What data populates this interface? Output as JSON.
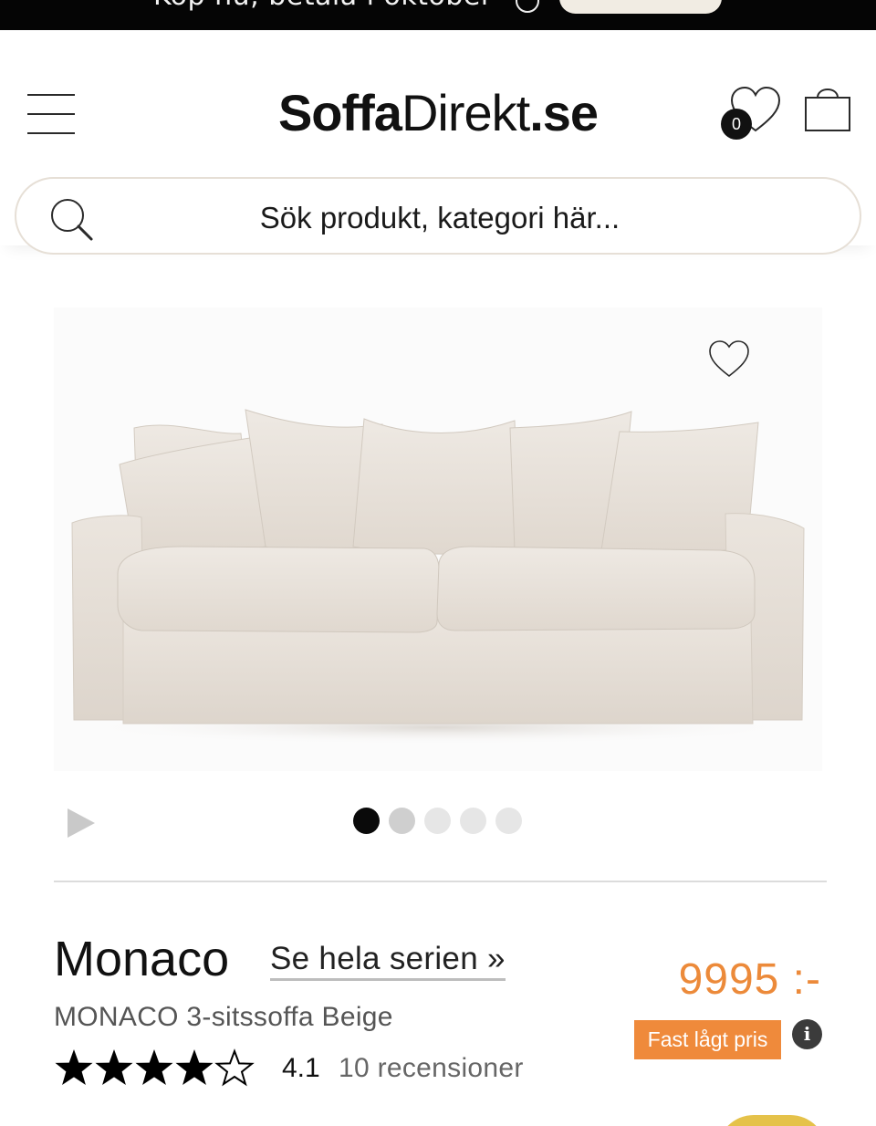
{
  "banner": {
    "text": "Köp nu, betala i oktober"
  },
  "header": {
    "logo_bold": "Soffa",
    "logo_light": "Direkt",
    "logo_suffix": ".se",
    "wishlist_count": "0"
  },
  "search": {
    "placeholder": "Sök produkt, kategori här..."
  },
  "gallery": {
    "image_subject": "beige three-seat sofa with loose cushions",
    "slide_count": 5,
    "active_slide": 1
  },
  "product": {
    "name": "Monaco",
    "series_link": "Se hela serien »",
    "subtitle": "MONACO 3-sitssoffa Beige",
    "rating_value": 4.1,
    "rating_text": "4.1",
    "reviews": "10 recensioner",
    "price": "9995 :-",
    "price_badge": "Fast lågt pris"
  },
  "colors": {
    "accent_orange": "#ef8a3b",
    "price_orange": "#ec8a3a",
    "search_border": "#e6dfd6",
    "sofa_fabric": "#e8e1d9"
  },
  "icons": {
    "menu": "hamburger-icon",
    "wishlist": "heart-icon",
    "cart": "shopping-bag-icon",
    "search": "magnifier-icon",
    "favorite": "heart-outline-icon",
    "play": "play-icon",
    "info": "info-icon",
    "star": "star-icon"
  }
}
